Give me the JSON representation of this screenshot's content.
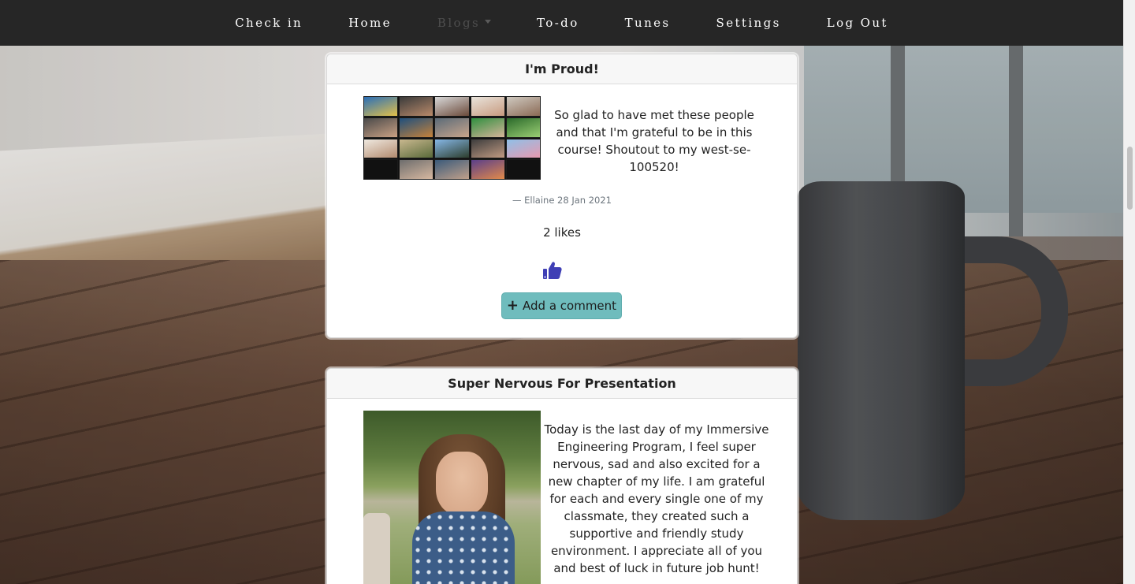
{
  "nav": {
    "items": [
      {
        "label": "Check in",
        "muted": false,
        "dropdown": false
      },
      {
        "label": "Home",
        "muted": false,
        "dropdown": false
      },
      {
        "label": "Blogs",
        "muted": true,
        "dropdown": true
      },
      {
        "label": "To-do",
        "muted": false,
        "dropdown": false
      },
      {
        "label": "Tunes",
        "muted": false,
        "dropdown": false
      },
      {
        "label": "Settings",
        "muted": false,
        "dropdown": false
      },
      {
        "label": "Log Out",
        "muted": false,
        "dropdown": false
      }
    ]
  },
  "posts": [
    {
      "title": "I'm Proud!",
      "text": "So glad to have met these people and that I'm grateful to be in this course! Shoutout to my west-se-100520!",
      "byline": "— Ellaine 28 Jan 2021",
      "likes": "2 likes",
      "comment_label": "Add a comment",
      "image_icon": "video-call-grid-image"
    },
    {
      "title": "Super Nervous For Presentation",
      "text": "Today is the last day of my Immersive Engineering Program, I feel super nervous, sad and also excited for a new chapter of my life. I am grateful for each and every single one of my classmate, they created such a supportive and friendly study environment. I appreciate all of you and best of luck in future job hunt!",
      "image_icon": "woman-outdoors-image"
    }
  ],
  "colors": {
    "navbar": "#262626",
    "accent_button": "#6fbcbd",
    "like_icon": "#3f3fb5"
  }
}
